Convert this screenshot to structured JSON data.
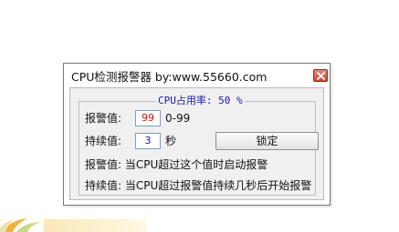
{
  "window": {
    "title": "CPU检测报警器 by:www.55660.com"
  },
  "group": {
    "title": "CPU占用率: 50 %"
  },
  "alarm": {
    "label": "报警值:",
    "value": "99",
    "range": "0-99"
  },
  "duration": {
    "label": "持续值:",
    "value": "3",
    "unit": "秒"
  },
  "lock_button": {
    "label": "锁定"
  },
  "help": {
    "alarm_text": "报警值: 当CPU超过这个值时启动报警",
    "duration_text": "持续值: 当CPU超过报警值持续几秒后开始报警"
  },
  "colors": {
    "accent_blue": "#1a1aa0",
    "alarm_red": "#d01010",
    "close_red": "#c84a36"
  },
  "icons": {
    "close": "close-icon"
  }
}
